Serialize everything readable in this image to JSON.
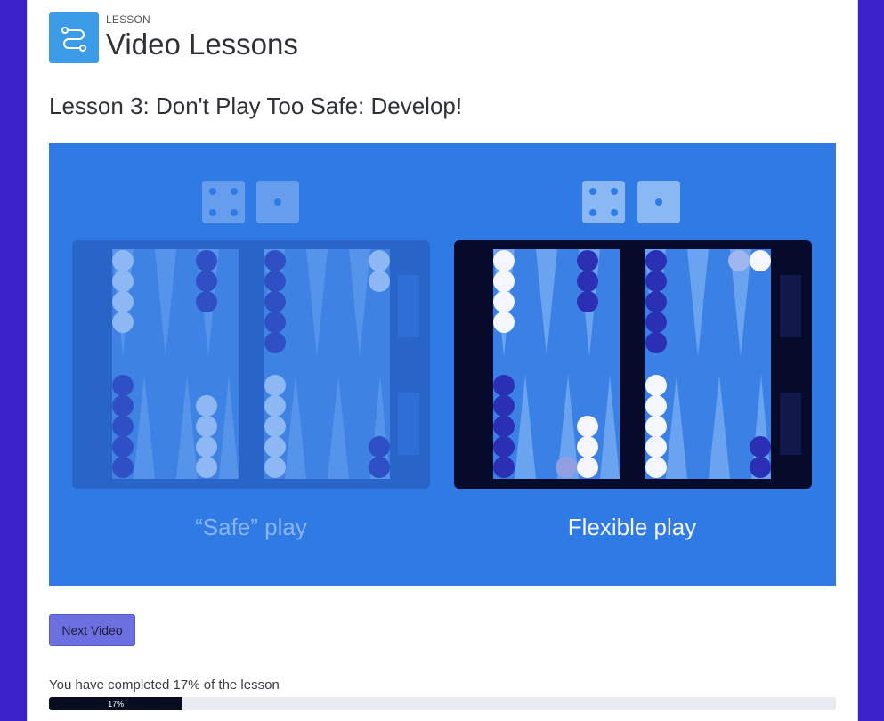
{
  "header": {
    "kicker": "LESSON",
    "title": "Video Lessons",
    "icon": "route-icon",
    "icon_bg": "#3b9be6"
  },
  "lesson": {
    "title": "Lesson 3: Don't Play Too Safe: Develop!"
  },
  "video": {
    "left_caption": "“Safe” play",
    "right_caption": "Flexible play",
    "background": "#2f7ae5"
  },
  "controls": {
    "next_label": "Next Video",
    "accent": "#6c6fe0"
  },
  "progress": {
    "text": "You have completed 17% of the lesson",
    "value": 17,
    "label": "17%"
  }
}
